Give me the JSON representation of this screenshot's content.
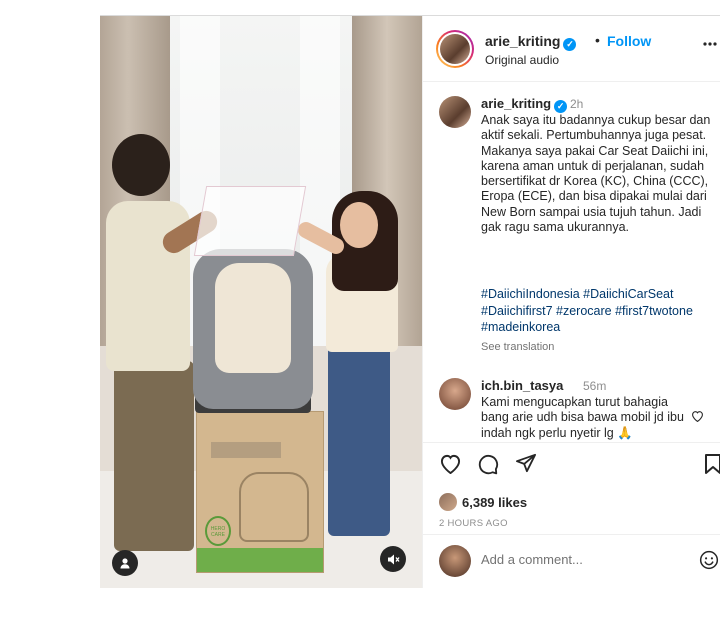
{
  "post": {
    "author": "arie_kriting",
    "follow_label": "Follow",
    "separator": "•",
    "verified_mark": "✓",
    "audio": "Original audio",
    "more_icon": "more-icon"
  },
  "caption": {
    "username": "arie_kriting",
    "time": "2h",
    "text": "Anak saya itu badannya cukup besar dan aktif sekali. Pertumbuhannya juga pesat. Makanya saya pakai Car Seat Daiichi ini, karena aman untuk di perjalanan, sudah bersertifikat dr Korea (KC), China (CCC), Eropa (ECE), dan bisa dipakai mulai dari New Born sampai usia tujuh tahun. Jadi gak ragu sama ukurannya.",
    "hashtags": "#DaiichiIndonesia #DaiichiCarSeat #Daiichifirst7 #zerocare #first7twotone #madeinkorea",
    "see_translation": "See translation"
  },
  "comment": {
    "username": "ich.bin_tasya",
    "time": "56m",
    "text": "Kami mengucapkan turut bahagia bang arie udh bisa bawa mobil jd ibu indah ngk perlu nyetir lg 🙏"
  },
  "actions": {
    "likes": "6,389 likes",
    "timestamp": "2 HOURS AGO"
  },
  "add_comment": {
    "placeholder": "Add a comment..."
  },
  "media": {
    "product_text": "HERO CARE"
  },
  "icons": [
    "heart-icon",
    "comment-icon",
    "share-icon",
    "bookmark-icon",
    "emoji-icon",
    "user-tag-icon",
    "mute-icon"
  ],
  "colors": {
    "accent": "#0095f6",
    "link": "#00376b",
    "muted": "#8e8e8e"
  }
}
